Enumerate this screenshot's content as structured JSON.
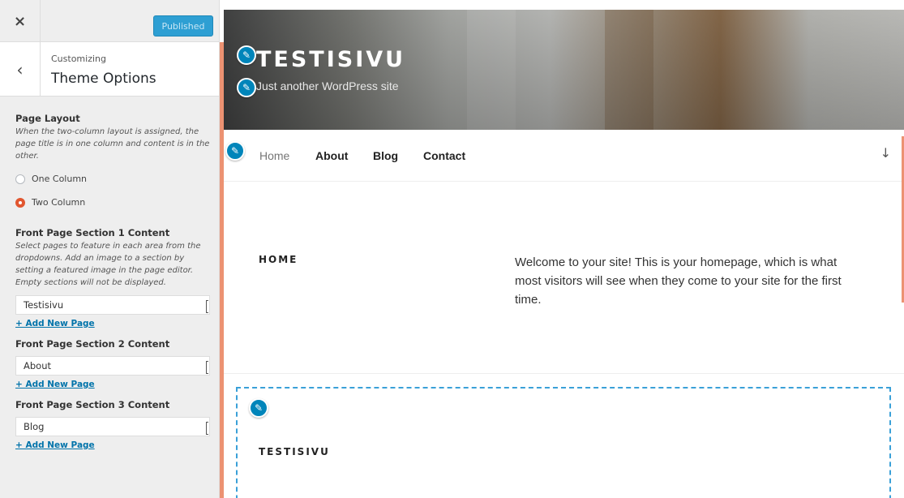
{
  "sidebar": {
    "close_icon": "×",
    "publish_label": "Published",
    "back_icon": "‹",
    "breadcrumb": "Customizing",
    "section_title": "Theme Options",
    "page_layout": {
      "title": "Page Layout",
      "description": "When the two-column layout is assigned, the page title is in one column and content is in the other.",
      "options": [
        {
          "label": "One Column",
          "checked": false
        },
        {
          "label": "Two Column",
          "checked": true
        }
      ]
    },
    "sections": [
      {
        "title": "Front Page Section 1 Content",
        "description": "Select pages to feature in each area from the dropdowns. Add an image to a section by setting a featured image in the page editor. Empty sections will not be displayed.",
        "selected": "Testisivu",
        "add_link": "+ Add New Page"
      },
      {
        "title": "Front Page Section 2 Content",
        "selected": "About",
        "add_link": "+ Add New Page"
      },
      {
        "title": "Front Page Section 3 Content",
        "selected": "Blog",
        "add_link": "+ Add New Page"
      }
    ],
    "accent_color": "#ec9272"
  },
  "preview": {
    "site_title": "TESTISIVU",
    "tagline": "Just another WordPress site",
    "nav": [
      "Home",
      "About",
      "Blog",
      "Contact"
    ],
    "scroll_icon": "↓",
    "home_section": {
      "label": "HOME",
      "text": "Welcome to your site! This is your homepage, which is what most visitors will see when they come to your site for the first time."
    },
    "panel_section": {
      "label": "TESTISIVU"
    },
    "edit_icon": "✎",
    "edit_color": "#0085ba"
  }
}
